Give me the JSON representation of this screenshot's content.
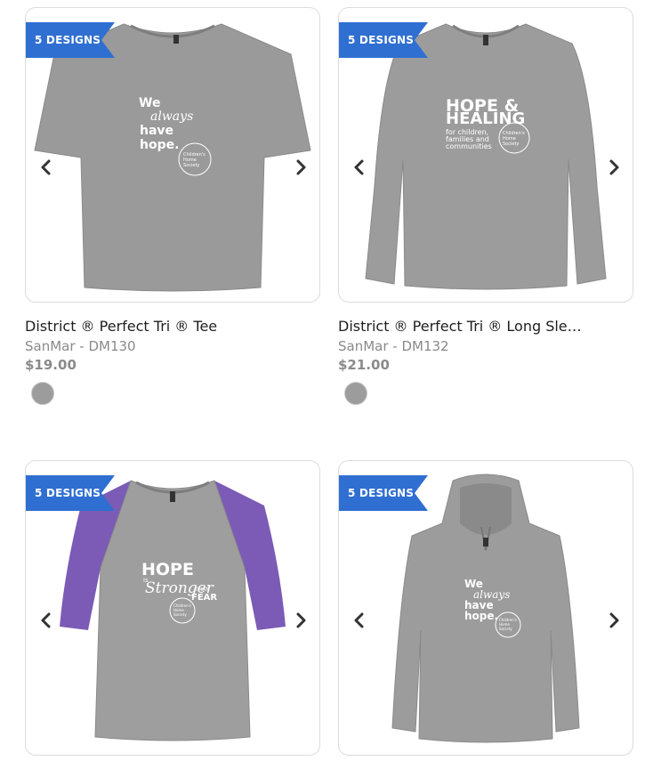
{
  "products": [
    {
      "badge": "5 DESIGNS",
      "title": "District ® Perfect Tri ® Tee",
      "sub": "SanMar - DM130",
      "price": "$19.00",
      "print": [
        "We",
        "always",
        "have",
        "hope."
      ],
      "logo": [
        "Children's",
        "Home",
        "Society"
      ],
      "swatches": [
        "#9c9c9c"
      ]
    },
    {
      "badge": "5 DESIGNS",
      "title": "District ® Perfect Tri ® Long Sleeve...",
      "sub": "SanMar - DM132",
      "price": "$21.00",
      "print": [
        "HOPE &",
        "HEALING",
        "for children,",
        "families and",
        "communities"
      ],
      "logo": [
        "Children's",
        "Home",
        "Society"
      ],
      "swatches": [
        "#9c9c9c"
      ]
    },
    {
      "badge": "5 DESIGNS",
      "print": [
        "HOPE",
        "is",
        "Stronger",
        "THAN",
        "FEAR"
      ],
      "logo": [
        "Children's",
        "Home",
        "Society"
      ]
    },
    {
      "badge": "5 DESIGNS",
      "print": [
        "We",
        "always",
        "have",
        "hope."
      ],
      "logo": [
        "Children's",
        "Home",
        "Society"
      ]
    }
  ]
}
